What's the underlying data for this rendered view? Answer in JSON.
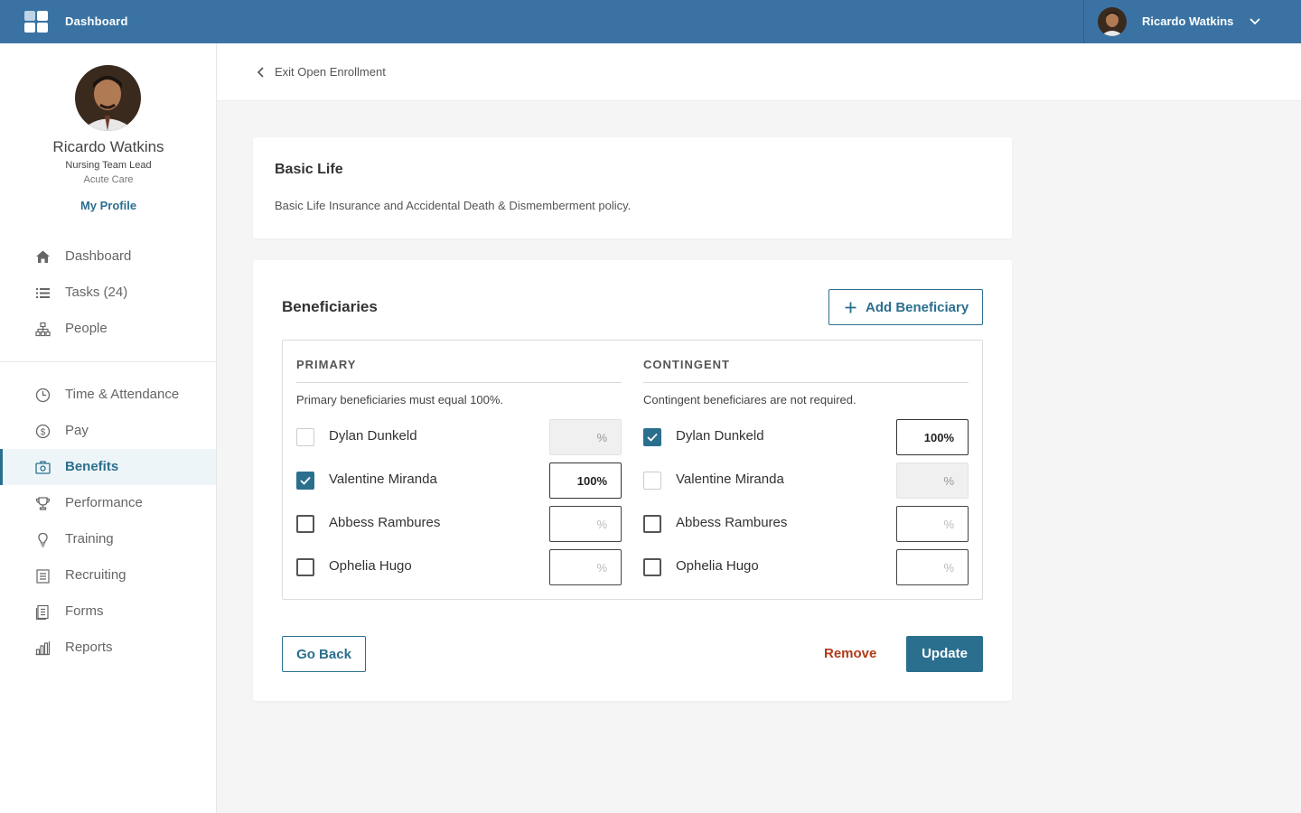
{
  "topbar": {
    "title": "Dashboard",
    "user_name": "Ricardo Watkins"
  },
  "profile": {
    "name": "Ricardo Watkins",
    "role": "Nursing Team Lead",
    "department": "Acute Care",
    "profile_link": "My Profile"
  },
  "nav": {
    "items": [
      {
        "label": "Dashboard",
        "icon": "home-icon"
      },
      {
        "label": "Tasks (24)",
        "icon": "list-icon"
      },
      {
        "label": "People",
        "icon": "org-chart-icon"
      },
      {
        "label": "Time & Attendance",
        "icon": "clock-icon"
      },
      {
        "label": "Pay",
        "icon": "dollar-icon"
      },
      {
        "label": "Benefits",
        "icon": "benefits-icon",
        "active": true
      },
      {
        "label": "Performance",
        "icon": "trophy-icon"
      },
      {
        "label": "Training",
        "icon": "lightbulb-icon"
      },
      {
        "label": "Recruiting",
        "icon": "clipboard-icon"
      },
      {
        "label": "Forms",
        "icon": "forms-icon"
      },
      {
        "label": "Reports",
        "icon": "bar-chart-icon"
      }
    ]
  },
  "header": {
    "back_label": "Exit Open Enrollment"
  },
  "plan": {
    "title": "Basic Life",
    "description": "Basic Life Insurance and Accidental Death & Dismemberment policy."
  },
  "beneficiaries": {
    "title": "Beneficiaries",
    "add_button": "Add Beneficiary",
    "primary": {
      "heading": "PRIMARY",
      "note": "Primary beneficiaries must equal 100%.",
      "rows": [
        {
          "name": "Dylan Dunkeld",
          "checked": false,
          "disabled": true,
          "value": "",
          "placeholder": "%"
        },
        {
          "name": "Valentine Miranda",
          "checked": true,
          "disabled": false,
          "value": "100%",
          "placeholder": "%"
        },
        {
          "name": "Abbess Rambures",
          "checked": false,
          "disabled": false,
          "value": "",
          "placeholder": "%"
        },
        {
          "name": "Ophelia Hugo",
          "checked": false,
          "disabled": false,
          "value": "",
          "placeholder": "%"
        }
      ]
    },
    "contingent": {
      "heading": "CONTINGENT",
      "note": "Contingent beneficiares are not required.",
      "rows": [
        {
          "name": "Dylan Dunkeld",
          "checked": true,
          "disabled": false,
          "value": "100%",
          "placeholder": "%"
        },
        {
          "name": "Valentine Miranda",
          "checked": false,
          "disabled": true,
          "value": "",
          "placeholder": "%"
        },
        {
          "name": "Abbess Rambures",
          "checked": false,
          "disabled": false,
          "value": "",
          "placeholder": "%"
        },
        {
          "name": "Ophelia Hugo",
          "checked": false,
          "disabled": false,
          "value": "",
          "placeholder": "%"
        }
      ]
    }
  },
  "actions": {
    "go_back": "Go Back",
    "remove": "Remove",
    "update": "Update"
  },
  "colors": {
    "topbar": "#3a73a3",
    "accent": "#2b6f8e",
    "danger": "#b23a1a"
  }
}
